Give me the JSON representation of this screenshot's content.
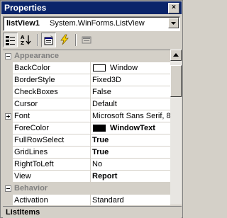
{
  "window": {
    "title": "Properties",
    "close_glyph": "×"
  },
  "object_selector": {
    "object": "listView1",
    "type": "System.WinForms.ListView"
  },
  "toolbar": {
    "buttons": [
      "categorized-icon",
      "alphabetical-icon",
      "properties-icon",
      "events-icon",
      "property-pages-icon"
    ]
  },
  "grid": {
    "categories": {
      "appearance": "Appearance",
      "behavior": "Behavior"
    },
    "rows": [
      {
        "name": "BackColor",
        "value": "Window"
      },
      {
        "name": "BorderStyle",
        "value": "Fixed3D"
      },
      {
        "name": "CheckBoxes",
        "value": "False"
      },
      {
        "name": "Cursor",
        "value": "Default"
      },
      {
        "name": "Font",
        "value": "Microsoft Sans Serif, 8"
      },
      {
        "name": "ForeColor",
        "value": "WindowText"
      },
      {
        "name": "FullRowSelect",
        "value": "True"
      },
      {
        "name": "GridLines",
        "value": "True"
      },
      {
        "name": "RightToLeft",
        "value": "No"
      },
      {
        "name": "View",
        "value": "Report"
      },
      {
        "name": "Activation",
        "value": "Standard"
      }
    ]
  },
  "colors": {
    "window_swatch": "#ffffff",
    "windowtext_swatch": "#000000",
    "title_bar": "#0a246a"
  },
  "status": {
    "label": "ListItems"
  }
}
